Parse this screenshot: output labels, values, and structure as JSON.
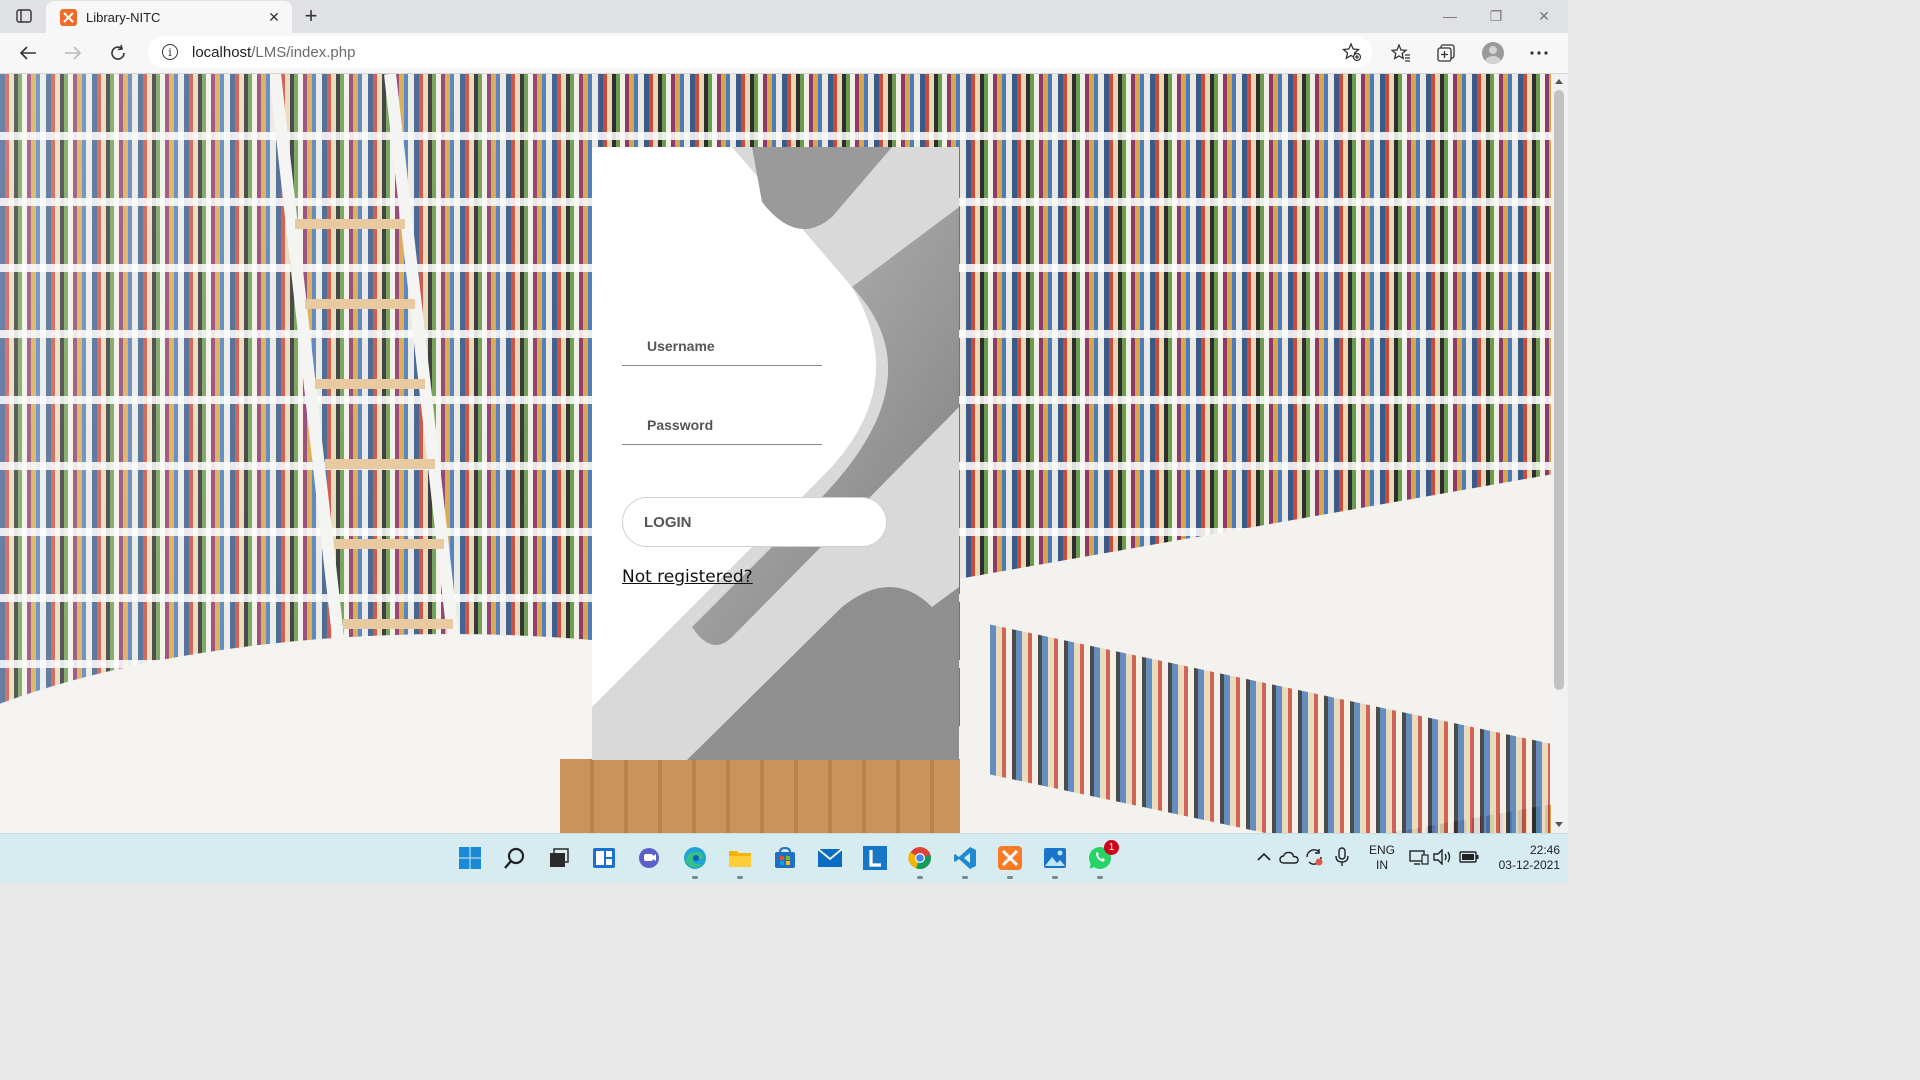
{
  "browser": {
    "tab_title": "Library-NITC",
    "url_host": "localhost",
    "url_path": "/LMS/index.php"
  },
  "login": {
    "username_placeholder": "Username",
    "password_placeholder": "Password",
    "login_label": "LOGIN",
    "register_link": "Not registered?"
  },
  "taskbar": {
    "apps": [
      "windows-start",
      "search",
      "task-view",
      "widgets",
      "teams-chat",
      "edge",
      "file-explorer",
      "microsoft-store",
      "mail",
      "app-l",
      "chrome",
      "vscode",
      "xampp",
      "photos",
      "whatsapp"
    ],
    "whatsapp_badge": "1",
    "language_top": "ENG",
    "language_bottom": "IN",
    "time": "22:46",
    "date": "03-12-2021"
  },
  "colors": {
    "card_grey_dark": "#8f8f8f",
    "card_grey_light": "#d9d9d9",
    "taskbar_bg": "#d7ecf0"
  }
}
